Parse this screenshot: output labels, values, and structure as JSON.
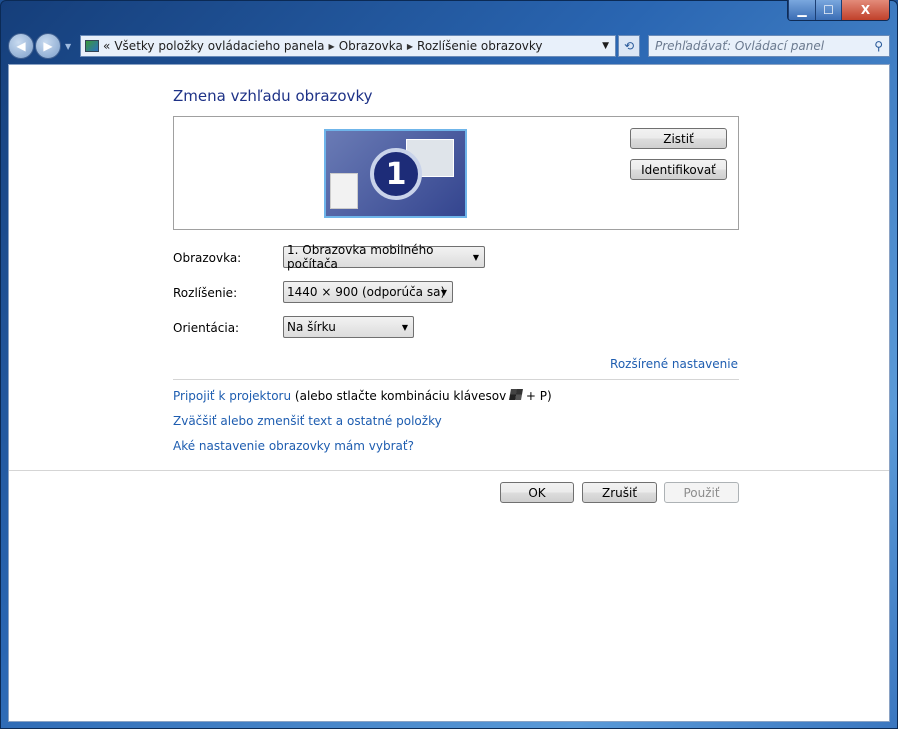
{
  "window": {
    "minimize": "▁",
    "maximize": "☐",
    "close": "X"
  },
  "nav": {
    "address": [
      "Všetky položky ovládacieho panela",
      "Obrazovka",
      "Rozlíšenie obrazovky"
    ],
    "address_prefix": "«",
    "search_placeholder": "Prehľadávať: Ovládací panel"
  },
  "main": {
    "title": "Zmena vzhľadu obrazovky",
    "monitor_number": "1",
    "detect": "Zistiť",
    "identify": "Identifikovať",
    "fields": [
      {
        "label": "Obrazovka:",
        "value": "1. Obrazovka mobilného počítača"
      },
      {
        "label": "Rozlíšenie:",
        "value": "1440 × 900 (odporúča sa)"
      },
      {
        "label": "Orientácia:",
        "value": "Na šírku"
      }
    ],
    "advanced": "Rozšírené nastavenie",
    "projector_link": "Pripojiť k projektoru",
    "projector_text": "(alebo stlačte kombináciu klávesov",
    "projector_key": "+ P)",
    "text_size_link": "Zväčšiť alebo zmenšiť text a ostatné položky",
    "help_link": "Aké nastavenie obrazovky mám vybrať?",
    "ok": "OK",
    "cancel": "Zrušiť",
    "apply": "Použiť"
  }
}
